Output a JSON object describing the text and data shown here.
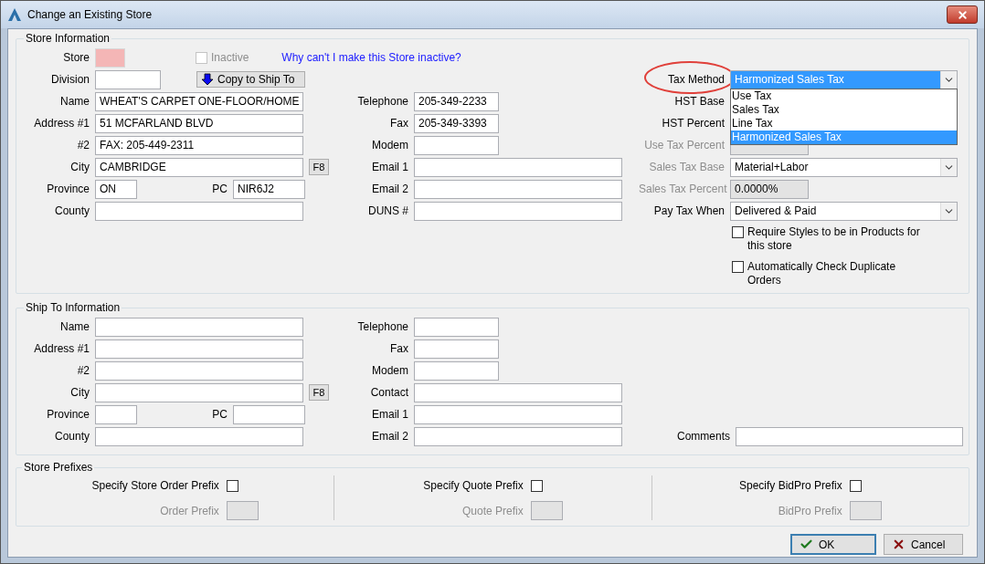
{
  "window": {
    "title": "Change an Existing Store"
  },
  "store_info": {
    "title": "Store Information",
    "store": {
      "label": "Store"
    },
    "inactive": {
      "label": "Inactive",
      "checked": false,
      "disabled": true
    },
    "help_link": "Why can't I make this Store inactive?",
    "division": {
      "label": "Division"
    },
    "copy_button": "Copy to Ship To",
    "address_fields": [
      {
        "kind": "wide",
        "label": "Name",
        "value": "WHEAT'S CARPET ONE-FLOOR/HOME"
      },
      {
        "kind": "wide",
        "label": "Address #1",
        "value": "51 MCFARLAND BLVD"
      },
      {
        "kind": "wide",
        "label": "#2",
        "value": "FAX: 205-449-2311"
      },
      {
        "kind": "lookup",
        "label": "City",
        "value": "CAMBRIDGE",
        "button": "F8"
      },
      {
        "kind": "pair",
        "label": "Province",
        "value": "ON",
        "second_label": "PC",
        "second_value": "NIR6J2"
      },
      {
        "kind": "wide",
        "label": "County"
      }
    ],
    "contact_fields": [
      {
        "kind": "short",
        "label": "Telephone",
        "value": "205-349-2233"
      },
      {
        "kind": "short",
        "label": "Fax",
        "value": "205-349-3393"
      },
      {
        "kind": "short",
        "label": "Modem"
      },
      {
        "kind": "wide",
        "label": "Email 1"
      },
      {
        "kind": "wide",
        "label": "Email 2"
      },
      {
        "kind": "wide",
        "label": "DUNS #"
      }
    ],
    "tax_method": {
      "label": "Tax Method",
      "value": "Harmonized Sales Tax",
      "circled": true,
      "expanded": true,
      "options": [
        {
          "label": "Use Tax",
          "selected": false
        },
        {
          "label": "Sales Tax",
          "selected": false
        },
        {
          "label": "Line Tax",
          "selected": false
        },
        {
          "label": "Harmonized Sales Tax",
          "selected": true
        }
      ]
    },
    "tax_fields": [
      {
        "kind": "covered",
        "label": "HST Base",
        "disabled": false
      },
      {
        "kind": "covered",
        "label": "HST Percent",
        "disabled": false
      },
      {
        "kind": "percent",
        "label": "Use Tax Percent",
        "disabled": true
      },
      {
        "kind": "combo",
        "label": "Sales Tax Base",
        "value": "Material+Labor",
        "disabled": true
      },
      {
        "kind": "percent",
        "label": "Sales Tax Percent",
        "value": "0.0000%",
        "disabled": true
      },
      {
        "kind": "combo",
        "label": "Pay Tax When",
        "value": "Delivered & Paid",
        "disabled": false
      }
    ],
    "options": [
      {
        "label": "Require Styles to be in Products for this store",
        "checked": false
      },
      {
        "label": "Automatically Check Duplicate Orders",
        "checked": false
      }
    ]
  },
  "ship_to": {
    "title": "Ship To Information",
    "address_fields": [
      {
        "kind": "wide",
        "label": "Name"
      },
      {
        "kind": "wide",
        "label": "Address #1"
      },
      {
        "kind": "wide",
        "label": "#2"
      },
      {
        "kind": "lookup",
        "label": "City",
        "button": "F8"
      },
      {
        "kind": "pair",
        "label": "Province",
        "second_label": "PC"
      },
      {
        "kind": "wide",
        "label": "County"
      }
    ],
    "contact_fields": [
      {
        "kind": "short",
        "label": "Telephone"
      },
      {
        "kind": "short",
        "label": "Fax"
      },
      {
        "kind": "short",
        "label": "Modem"
      },
      {
        "kind": "wide",
        "label": "Contact"
      },
      {
        "kind": "wide",
        "label": "Email 1"
      },
      {
        "kind": "wide",
        "label": "Email 2"
      }
    ],
    "comments": {
      "label": "Comments"
    }
  },
  "prefixes": {
    "title": "Store Prefixes",
    "items": [
      {
        "checkbox_label": "Specify Store Order Prefix",
        "checked": false,
        "field_label": "Order Prefix",
        "disabled": true
      },
      {
        "checkbox_label": "Specify Quote Prefix",
        "checked": false,
        "field_label": "Quote Prefix",
        "disabled": true
      },
      {
        "checkbox_label": "Specify BidPro Prefix",
        "checked": false,
        "field_label": "BidPro Prefix",
        "disabled": true
      }
    ]
  },
  "buttons": [
    {
      "kind": "ok",
      "label": "OK",
      "default": true
    },
    {
      "kind": "cancel",
      "label": "Cancel",
      "default": false
    }
  ]
}
